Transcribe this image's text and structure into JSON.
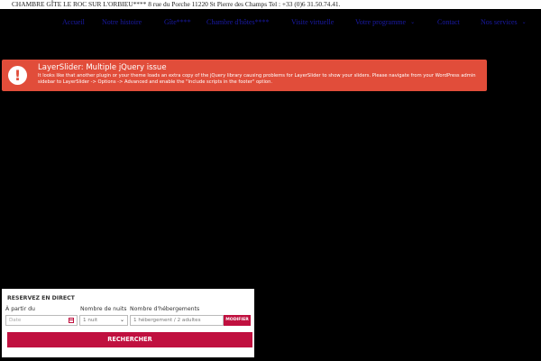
{
  "topbar": {
    "text": "CHAMBRE GÎTE LE ROC SUR L'ORBIEU**** 8 rue du Porche 11220 St Pierre des Champs Tel : +33 (0)6 31.50.74.41."
  },
  "nav": {
    "items": [
      {
        "label": "Accueil"
      },
      {
        "label": "Notre histoire"
      },
      {
        "label": "Gîte****"
      },
      {
        "label": "Chambre d'hôtes****"
      },
      {
        "label": "Visite virtuelle"
      },
      {
        "label": "Votre programme"
      },
      {
        "label": "Contact"
      },
      {
        "label": "Nos services"
      }
    ]
  },
  "alert": {
    "icon": "exclamation-icon",
    "icon_glyph": "!",
    "title": "LayerSlider: Multiple jQuery issue",
    "body": "It looks like that another plugin or your theme loads an extra copy of the jQuery library causing problems for LayerSlider to show your sliders. Please navigate from your WordPress admin sidebar to LayerSlider -> Options -> Advanced and enable the \"Include scripts in the footer\" option.",
    "color": "#e14d3a"
  },
  "booking": {
    "title": "RESERVEZ EN DIRECT",
    "date_label": "À partir du",
    "date_placeholder": "Date",
    "nights_label": "Nombre de nuits",
    "nights_value": "1 nuit",
    "rooms_label": "Nombre d'hébergements",
    "rooms_value": "1 hébergement / 2 adultes",
    "modify_label": "MODIFIER",
    "search_label": "RECHERCHER",
    "accent_color": "#c0103f"
  }
}
